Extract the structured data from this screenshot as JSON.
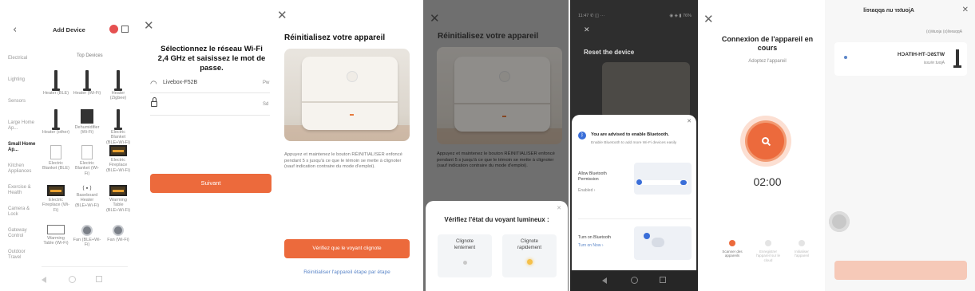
{
  "panel1": {
    "title": "Add Device",
    "back_icon": "chevron-left-icon",
    "header_icons": [
      "red-badge-icon",
      "scan-icon"
    ],
    "section_label": "Top Devices",
    "categories": [
      "Electrical",
      "Lighting",
      "Sensors",
      "Large Home Ap...",
      "Small Home Ap...",
      "Kitchen Appliances",
      "Exercise & Health",
      "Camera & Lock",
      "Gateway Control",
      "Outdoor Travel"
    ],
    "devices": [
      {
        "label": "Heater (BLE)",
        "icon": "pole"
      },
      {
        "label": "Heater (Wi-Fi)",
        "icon": "pole"
      },
      {
        "label": "Heater (Zigbee)",
        "icon": "pole"
      },
      {
        "label": "Heater (other)",
        "icon": "pole"
      },
      {
        "label": "Dehumidifier (Wi-Fi)",
        "icon": "square"
      },
      {
        "label": "Electric Blanket (BLE+Wi-Fi)",
        "icon": "pole"
      },
      {
        "label": "Electric Blanket (BLE)",
        "icon": "card"
      },
      {
        "label": "Electric Blanket (Wi-Fi)",
        "icon": "card"
      },
      {
        "label": "Electric Fireplace (BLE+Wi-Fi)",
        "icon": "fire"
      },
      {
        "label": "Electric Fireplace (Wi-Fi)",
        "icon": "fire"
      },
      {
        "label": "Baseboard Heater (BLE+Wi-Fi)",
        "icon": "baseboard"
      },
      {
        "label": "Warming Table (BLE+Wi-Fi)",
        "icon": "fire"
      },
      {
        "label": "Warming Table (Wi-Fi)",
        "icon": "table"
      },
      {
        "label": "Fan (BLE+Wi-Fi)",
        "icon": "fan"
      },
      {
        "label": "Fan (Wi-Fi)",
        "icon": "fan"
      }
    ],
    "bottom_nav": [
      "back-nav-icon",
      "home-nav-icon",
      "recent-nav-icon"
    ]
  },
  "panel2": {
    "close_icon": "close-icon",
    "heading": "Sélectionnez le réseau Wi-Fi 2,4 GHz et saisissez le mot de passe.",
    "wifi_icon": "wifi-icon",
    "ssid_value": "Livebox-F52B",
    "ssid_action": "Pw",
    "lock_icon": "lock-icon",
    "password_value": "",
    "password_action": "Sd",
    "next_label": "Suivant"
  },
  "panel3": {
    "close_icon": "close-icon",
    "heading": "Réinitialisez votre appareil",
    "description": "Appuyez et maintenez le bouton RÉINITIALISER enfoncé pendant 5 s jusqu'à ce que le témoin se mette à clignoter (sauf indication contraire du mode d'emploi).",
    "confirm_label": "Vérifiez que le voyant clignote",
    "link_label": "Réinitialiser l'appareil étape par étape"
  },
  "panel4": {
    "close_icon": "close-icon",
    "heading": "Réinitialisez votre appareil",
    "description": "Appuyez et maintenez le bouton RÉINITIALISER enfoncé pendant 5 s jusqu'à ce que le témoin se mette à clignoter (sauf indication contraire du mode d'emploi).",
    "sheet_title": "Vérifiez l'état du voyant lumineux :",
    "option_slow": "Clignote lentement",
    "option_fast": "Clignote rapidement"
  },
  "panel5": {
    "status_left": "11:47 ✆ ◫ ···",
    "status_right": "◉ ◈ ▮ 76%",
    "close_icon": "close-icon",
    "heading": "Reset the device",
    "dialog_title": "You are advised to enable Bluetooth.",
    "dialog_sub": "Enable Bluetooth to add more Wi-Fi devices easily",
    "step1_title": "Allow Bluetooth Permission",
    "step1_action": "Enabled ›",
    "step2_title": "Turn on Bluetooth",
    "step2_action": "Turn on Now ›"
  },
  "panel6": {
    "close_icon": "close-icon",
    "heading": "Connexion de l'appareil en cours",
    "subheading": "Adoptez l'appareil",
    "timer": "02:00",
    "search_icon": "search-icon",
    "steps": [
      "Scanner des appareils",
      "Enregistrer l'appareil sur le cloud",
      "Initialiser l'appareil"
    ]
  },
  "panel7": {
    "title": "Ajouter un appareil",
    "close_icon": "close-icon",
    "hint": "Appareil(s) ajouté(s)",
    "device_name": "WT26C-TH-HITACH",
    "device_sub": "Ajout réussi",
    "button_label": ""
  },
  "colors": {
    "accent": "#ec6a3c",
    "accent_light": "#f6a47d",
    "dim_overlay": "#000000",
    "phone_bg": "#2e2e2e"
  }
}
